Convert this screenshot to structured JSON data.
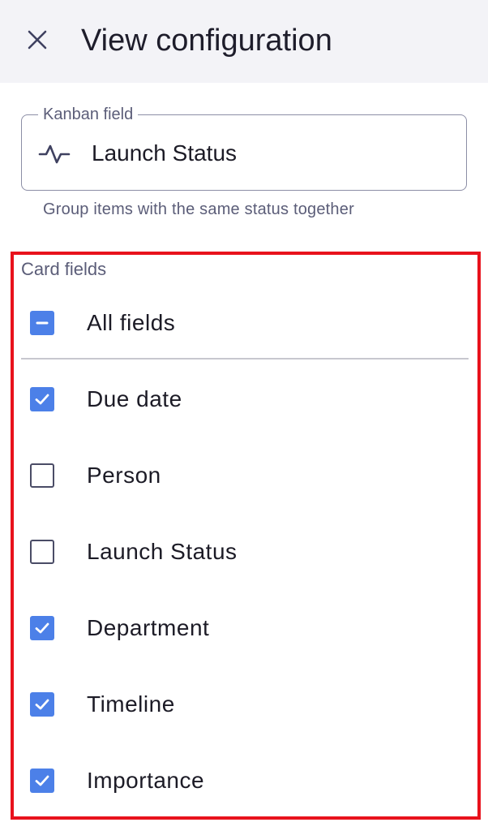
{
  "header": {
    "title": "View configuration",
    "close_icon": "close-icon"
  },
  "kanban": {
    "legend": "Kanban field",
    "value": "Launch Status",
    "icon": "activity-pulse-icon",
    "help": "Group items with the same status together"
  },
  "card_fields": {
    "label": "Card fields",
    "all": {
      "label": "All fields",
      "state": "indeterminate"
    },
    "items": [
      {
        "label": "Due date",
        "checked": true
      },
      {
        "label": "Person",
        "checked": false
      },
      {
        "label": "Launch Status",
        "checked": false
      },
      {
        "label": "Department",
        "checked": true
      },
      {
        "label": "Timeline",
        "checked": true
      },
      {
        "label": "Importance",
        "checked": true
      }
    ]
  },
  "colors": {
    "accent": "#4c80e8",
    "highlight": "#e8121c",
    "header_bg": "#f3f3f7"
  }
}
